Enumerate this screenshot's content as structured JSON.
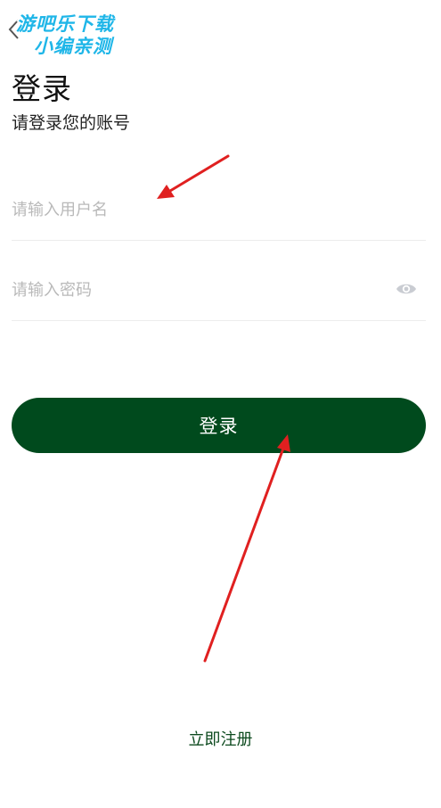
{
  "watermark": {
    "line1": "游吧乐下载",
    "line2": "小编亲测"
  },
  "header": {
    "title": "登录",
    "subtitle": "请登录您的账号"
  },
  "form": {
    "username_placeholder": "请输入用户名",
    "password_placeholder": "请输入密码",
    "login_label": "登录"
  },
  "footer": {
    "register_label": "立即注册"
  },
  "colors": {
    "primary": "#004a1d",
    "link": "#0c4a1e",
    "placeholder": "#b9b9b9",
    "annotation": "#e02020",
    "watermark": "#1fb6e8"
  },
  "icons": {
    "back": "chevron-left-icon",
    "password_visibility": "eye-icon"
  }
}
